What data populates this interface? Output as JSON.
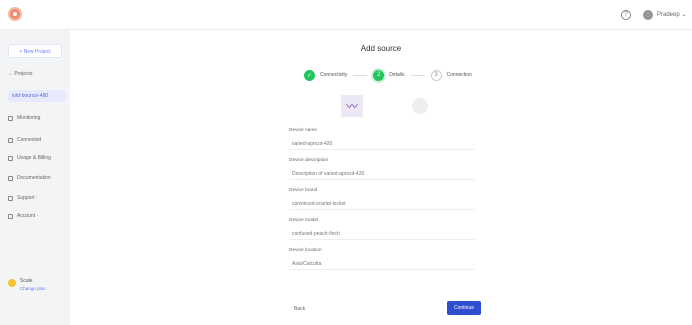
{
  "topbar": {
    "user_label": "Pradeep ⌄",
    "help_glyph": "?"
  },
  "sidebar": {
    "new_project": "+ New Project",
    "items": [
      {
        "label": "← Projects",
        "icon": "arrow-left-icon"
      },
      {
        "label": "iotd-bounce-480",
        "icon": "project-icon"
      },
      {
        "label": "Monitoring",
        "icon": "chart-icon"
      },
      {
        "label": "Connected",
        "icon": "plug-icon"
      },
      {
        "label": "Usage & Billing",
        "icon": "wallet-icon"
      },
      {
        "label": "Documentation",
        "icon": "document-icon"
      },
      {
        "label": "Support ·",
        "icon": "help-icon"
      },
      {
        "label": "Account ·",
        "icon": "user-icon"
      }
    ],
    "plan_label": "Scale",
    "plan_link": "Change plan"
  },
  "main": {
    "title": "Add source",
    "steps": [
      {
        "label": "Connectivity",
        "glyph": "✓",
        "state": "done"
      },
      {
        "label": "Details",
        "glyph": "2",
        "state": "current"
      },
      {
        "label": "Connection",
        "glyph": "3",
        "state": "todo"
      }
    ],
    "device_glyph": "〰",
    "fields": [
      {
        "label": "Device name",
        "value": "varied-apricot-420"
      },
      {
        "label": "Device description",
        "value": "Description of varied-apricot-420"
      },
      {
        "label": "Device brand",
        "value": "convinced-scarlet-locket"
      },
      {
        "label": "Device model",
        "value": "confused-peach-finch"
      },
      {
        "label": "Device location",
        "value": "Asia/Calcutta"
      }
    ],
    "back_label": "Back",
    "continue_label": "Continue"
  }
}
